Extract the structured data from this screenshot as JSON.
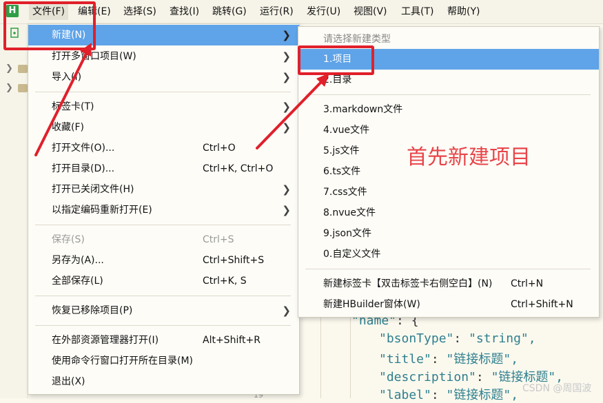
{
  "app_icon": "H",
  "menubar": [
    {
      "label": "文件(F)"
    },
    {
      "label": "编辑(E)"
    },
    {
      "label": "选择(S)"
    },
    {
      "label": "查找(I)"
    },
    {
      "label": "跳转(G)"
    },
    {
      "label": "运行(R)"
    },
    {
      "label": "发行(U)"
    },
    {
      "label": "视图(V)"
    },
    {
      "label": "工具(T)"
    },
    {
      "label": "帮助(Y)"
    }
  ],
  "file_menu": {
    "items": [
      {
        "label": "新建(N)"
      },
      {
        "label": "打开多窗口项目(W)"
      },
      {
        "label": "导入(I)"
      },
      {
        "label": "标签卡(T)"
      },
      {
        "label": "收藏(F)"
      },
      {
        "label": "打开文件(O)...",
        "shortcut": "Ctrl+O"
      },
      {
        "label": "打开目录(D)...",
        "shortcut": "Ctrl+K, Ctrl+O"
      },
      {
        "label": "打开已关闭文件(H)"
      },
      {
        "label": "以指定编码重新打开(E)"
      },
      {
        "label": "保存(S)",
        "shortcut": "Ctrl+S"
      },
      {
        "label": "另存为(A)...",
        "shortcut": "Ctrl+Shift+S"
      },
      {
        "label": "全部保存(L)",
        "shortcut": "Ctrl+K, S"
      },
      {
        "label": "恢复已移除项目(P)"
      },
      {
        "label": "在外部资源管理器打开(I)",
        "shortcut": "Alt+Shift+R"
      },
      {
        "label": "使用命令行窗口打开所在目录(M)"
      },
      {
        "label": "退出(X)"
      }
    ]
  },
  "new_submenu": {
    "header": "请选择新建类型",
    "items": [
      {
        "label": "1.项目"
      },
      {
        "label": "2.目录"
      },
      {
        "label": "3.markdown文件"
      },
      {
        "label": "4.vue文件"
      },
      {
        "label": "5.js文件"
      },
      {
        "label": "6.ts文件"
      },
      {
        "label": "7.css文件"
      },
      {
        "label": "8.nvue文件"
      },
      {
        "label": "9.json文件"
      },
      {
        "label": "0.自定义文件"
      },
      {
        "label": "新建标签卡【双击标签卡右侧空白】(N)",
        "shortcut": "Ctrl+N"
      },
      {
        "label": "新建HBuilder窗体(W)",
        "shortcut": "Ctrl+Shift+N"
      }
    ]
  },
  "annotation": "首先新建项目",
  "editor": {
    "lines": [
      {
        "key": "\"name\"",
        "rest": ": {"
      },
      {
        "key": "\"bsonType\"",
        "rest": ": ",
        "val": "\"string\","
      },
      {
        "key": "\"title\"",
        "rest": ": ",
        "val": "\"链接标题\","
      },
      {
        "key": "\"description\"",
        "rest": ": ",
        "val": "\"链接标题\","
      },
      {
        "key": "\"label\"",
        "rest": ": ",
        "val": "\"链接标题\","
      }
    ],
    "line_number": "19"
  },
  "watermark": "CSDN @周国波",
  "colors": {
    "highlight": "#5fa3e8",
    "annotation": "#e0202a",
    "brand": "#2e9e46"
  }
}
